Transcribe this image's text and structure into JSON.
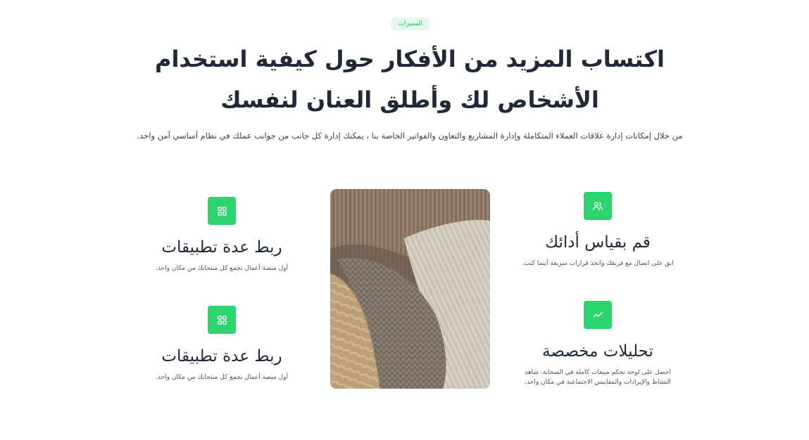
{
  "section": {
    "badge": "المميزات",
    "title_line1": "اكتساب المزيد من الأفكار حول كيفية استخدام",
    "title_line2": "الأشخاص لك وأطلق العنان لنفسك",
    "lead": "من خلال إمكانات إدارة علاقات العملاء المتكاملة وإدارة المشاريع والتعاون والفواتير الخاصة بنا ، يمكنك إدارة كل جانب من جوانب عملك في نظام أساسي آمن واحد."
  },
  "features": [
    {
      "icon": "users-icon",
      "title": "قم بقياس أدائك",
      "desc": "ابق على اتصال مع فريقك واتخذ قرارات سريعة أينما كنت."
    },
    {
      "icon": "trending-icon",
      "title": "تحليلات مخصصة",
      "desc": "احصل على لوحة تحكم مبيعات كاملة في السحابة. شاهد النشاط والإيرادات والمقاييس الاجتماعية في مكان واحد."
    },
    {
      "icon": "grid-icon",
      "title": "ربط عدة تطبيقات",
      "desc": "أول منصة أعمال تجمع كل منتجاتك من مكان واحد."
    },
    {
      "icon": "grid-icon",
      "title": "ربط عدة تطبيقات",
      "desc": "أول منصة أعمال تجمع كل منتجاتك من مكان واحد."
    }
  ],
  "photo": {
    "subject": "knitted-sweaters-image"
  },
  "colors": {
    "accent": "#2dd36f",
    "badge_bg": "#e6f7ec",
    "text": "#1f2937"
  }
}
